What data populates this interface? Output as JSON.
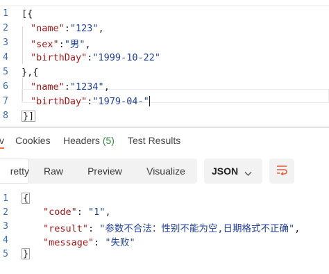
{
  "request_body": {
    "lines": [
      {
        "num": "1",
        "text": "[{"
      },
      {
        "num": "2",
        "key": "\"name\"",
        "value": "\"123\"",
        "trail": ","
      },
      {
        "num": "3",
        "key": "\"sex\"",
        "value": "\"男\"",
        "trail": ","
      },
      {
        "num": "4",
        "key": "\"birthDay\"",
        "value": "\"1999-10-22\"",
        "trail": ""
      },
      {
        "num": "5",
        "text": "},{"
      },
      {
        "num": "6",
        "key": "\"name\"",
        "value": "\"1234\"",
        "trail": ","
      },
      {
        "num": "7",
        "key": "\"birthDay\"",
        "value": "\"1979-04-\"",
        "trail": ""
      },
      {
        "num": "8",
        "text": "}]"
      }
    ]
  },
  "response_tabs": {
    "body": "v",
    "cookies": "Cookies",
    "headers": "Headers",
    "headers_count": "(5)",
    "test_results": "Test Results"
  },
  "format_toolbar": {
    "pretty": "retty",
    "raw": "Raw",
    "preview": "Preview",
    "visualize": "Visualize",
    "language": "JSON",
    "language_icon": "chevron-down-icon",
    "wrap_icon": "wrap-lines-icon",
    "accent_color": "#ff6c37"
  },
  "response_body": {
    "lines": [
      {
        "num": "1",
        "text": "{"
      },
      {
        "num": "2",
        "key": "\"code\"",
        "value": "\"1\"",
        "trail": ","
      },
      {
        "num": "3",
        "key": "\"result\"",
        "value": "\"参数不合法：性别不能为空,日期格式不正确\"",
        "trail": ","
      },
      {
        "num": "4",
        "key": "\"message\"",
        "value": "\"失败\"",
        "trail": ""
      },
      {
        "num": "5",
        "text": "}"
      }
    ]
  }
}
